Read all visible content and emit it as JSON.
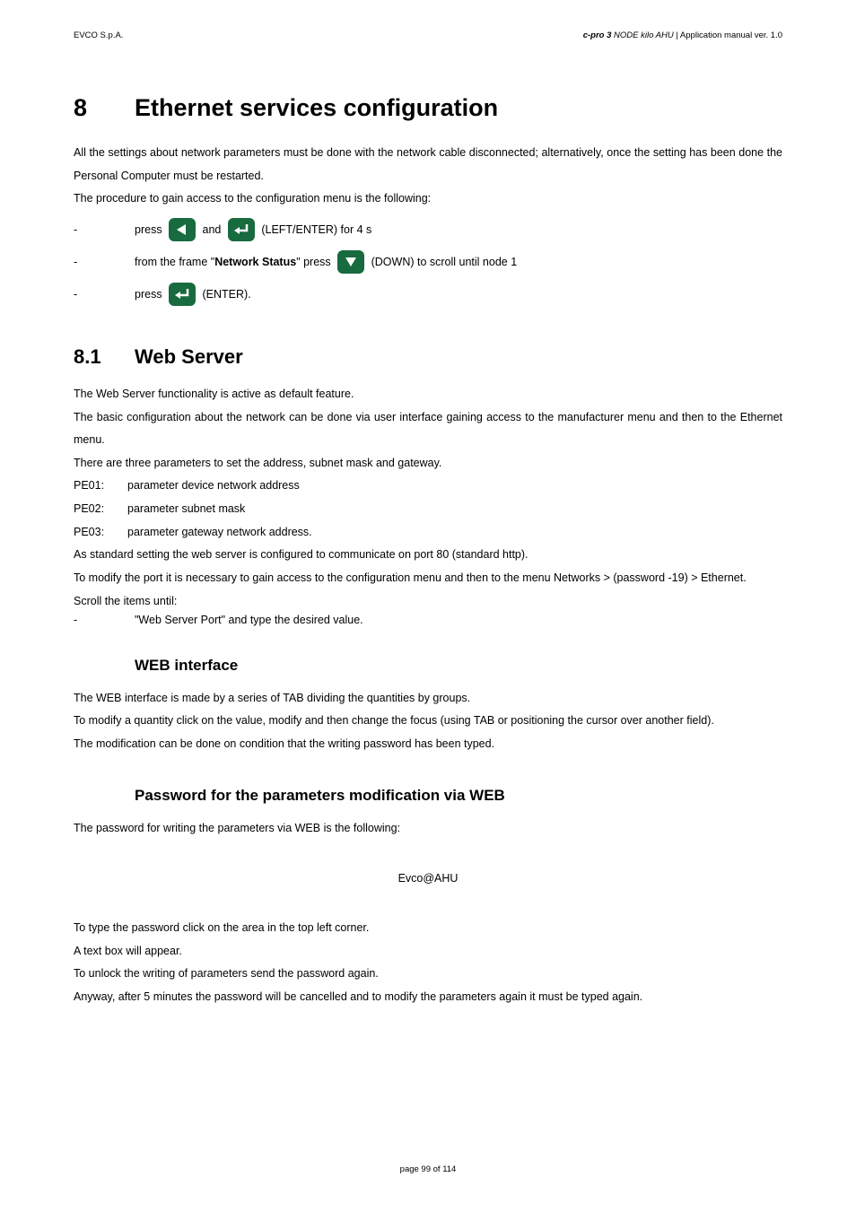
{
  "header": {
    "left": "EVCO S.p.A.",
    "right_bold_italic": "c-pro 3",
    "right_italic": " NODE kilo AHU",
    "right_plain": " | Application manual ver. 1.0"
  },
  "chapter": {
    "number": "8",
    "title": "Ethernet services configuration"
  },
  "intro": {
    "p1": "All the settings about network parameters must be done with the network cable disconnected; alternatively, once the setting has been done the Personal Computer must be restarted.",
    "p2": "The procedure to gain access to the configuration menu is the following:"
  },
  "steps": {
    "s1_pre": "press ",
    "s1_mid": " and ",
    "s1_post": " (LEFT/ENTER) for 4 s",
    "s2_pre": "from the frame \"",
    "s2_bold": "Network Status",
    "s2_mid": "\" press ",
    "s2_post": " (DOWN) to scroll until node 1",
    "s3_pre": "press ",
    "s3_post": " (ENTER)."
  },
  "section81": {
    "number": "8.1",
    "title": "Web Server",
    "p1": "The Web Server functionality is active as default feature.",
    "p2": "The basic configuration about the network can be done via user interface gaining access to the manufacturer menu and then to the Ethernet menu.",
    "p3": "There are three parameters to set the address, subnet mask and gateway.",
    "params": {
      "pe01_code": "PE01:",
      "pe01_desc": "parameter device network address",
      "pe02_code": "PE02:",
      "pe02_desc": "parameter subnet mask",
      "pe03_code": "PE03:",
      "pe03_desc": "parameter gateway network address."
    },
    "p4": "As standard setting the web server is configured to communicate on port 80 (standard http).",
    "p5": "To modify the port it is necessary to gain access to the configuration menu and then to the menu Networks > (password -19) > Ethernet.",
    "p6": "Scroll the items until:",
    "b1": "\"Web Server Port\" and type the desired value."
  },
  "web_interface": {
    "title": "WEB interface",
    "p1": "The WEB interface is made by a series of TAB dividing the quantities by groups.",
    "p2": "To modify a quantity click on the value, modify and then change the focus (using TAB or positioning the cursor over another field).",
    "p3": "The modification can be done on condition that the writing password has been typed."
  },
  "password_section": {
    "title": "Password for the parameters modification via WEB",
    "p1": "The password for writing the parameters via WEB is the following:",
    "password": "Evco@AHU",
    "p2": "To type the password click on the area in the top left corner.",
    "p3": "A text box will appear.",
    "p4": "To unlock the writing of parameters send the password again.",
    "p5": "Anyway, after 5 minutes the password will be cancelled and to modify the parameters again it must be typed again."
  },
  "footer": {
    "text": "page 99 of 114"
  }
}
